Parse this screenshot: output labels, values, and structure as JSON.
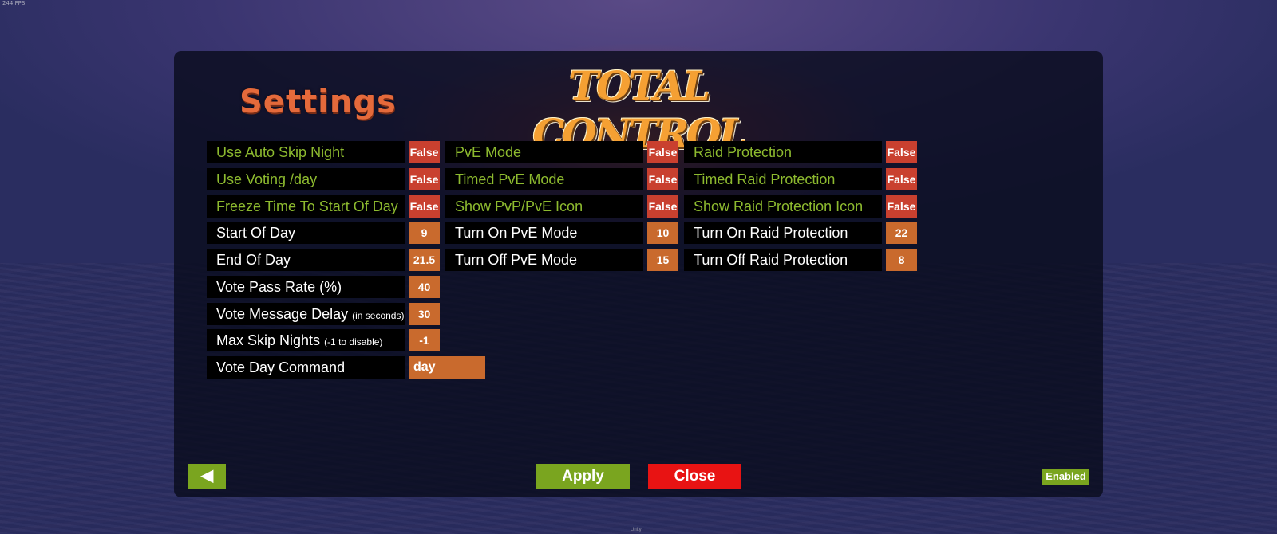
{
  "overlay": {
    "fps": "244 FPS",
    "bottom_mark": "Unity"
  },
  "header": {
    "logo_text": "TOTAL CONTROL",
    "settings_title": "Settings"
  },
  "column1": [
    {
      "label": "Use Auto Skip Night",
      "note": "",
      "value": "False",
      "kind": "bool",
      "label_color": "green"
    },
    {
      "label": "Use Voting /day",
      "note": "",
      "value": "False",
      "kind": "bool",
      "label_color": "green"
    },
    {
      "label": "Freeze Time To Start Of Day",
      "note": "",
      "value": "False",
      "kind": "bool",
      "label_color": "green"
    },
    {
      "label": "Start Of Day",
      "note": "",
      "value": "9",
      "kind": "num",
      "label_color": "white"
    },
    {
      "label": "End Of Day",
      "note": "",
      "value": "21.5",
      "kind": "num",
      "label_color": "white"
    },
    {
      "label": "Vote Pass Rate (%)",
      "note": "",
      "value": "40",
      "kind": "num",
      "label_color": "white"
    },
    {
      "label": "Vote Message Delay",
      "note": "(in seconds)",
      "value": "30",
      "kind": "num",
      "label_color": "white"
    },
    {
      "label": "Max Skip Nights",
      "note": "(-1 to disable)",
      "value": "-1",
      "kind": "num",
      "label_color": "white"
    },
    {
      "label": "Vote Day Command",
      "note": "",
      "value": "day",
      "kind": "text",
      "label_color": "white"
    }
  ],
  "column2": [
    {
      "label": "PvE Mode",
      "value": "False",
      "kind": "bool",
      "label_color": "green"
    },
    {
      "label": "Timed PvE Mode",
      "value": "False",
      "kind": "bool",
      "label_color": "green"
    },
    {
      "label": "Show PvP/PvE Icon",
      "value": "False",
      "kind": "bool",
      "label_color": "green"
    },
    {
      "label": "Turn On PvE Mode",
      "value": "10",
      "kind": "num",
      "label_color": "white"
    },
    {
      "label": "Turn Off PvE Mode",
      "value": "15",
      "kind": "num",
      "label_color": "white"
    }
  ],
  "column3": [
    {
      "label": "Raid Protection",
      "value": "False",
      "kind": "bool",
      "label_color": "green"
    },
    {
      "label": "Timed Raid Protection",
      "value": "False",
      "kind": "bool",
      "label_color": "green"
    },
    {
      "label": "Show Raid Protection Icon",
      "value": "False",
      "kind": "bool",
      "label_color": "green"
    },
    {
      "label": "Turn On Raid Protection",
      "value": "22",
      "kind": "num",
      "label_color": "white"
    },
    {
      "label": "Turn Off Raid Protection",
      "value": "8",
      "kind": "num",
      "label_color": "white"
    }
  ],
  "footer": {
    "back_icon": "◀",
    "apply_label": "Apply",
    "close_label": "Close",
    "status_badge": "Enabled"
  },
  "colors": {
    "green_label": "#8dba2f",
    "bool_value_bg": "#c9402f",
    "num_value_bg": "#c96a2d",
    "apply_bg": "#7aa51f",
    "close_bg": "#e81313"
  }
}
